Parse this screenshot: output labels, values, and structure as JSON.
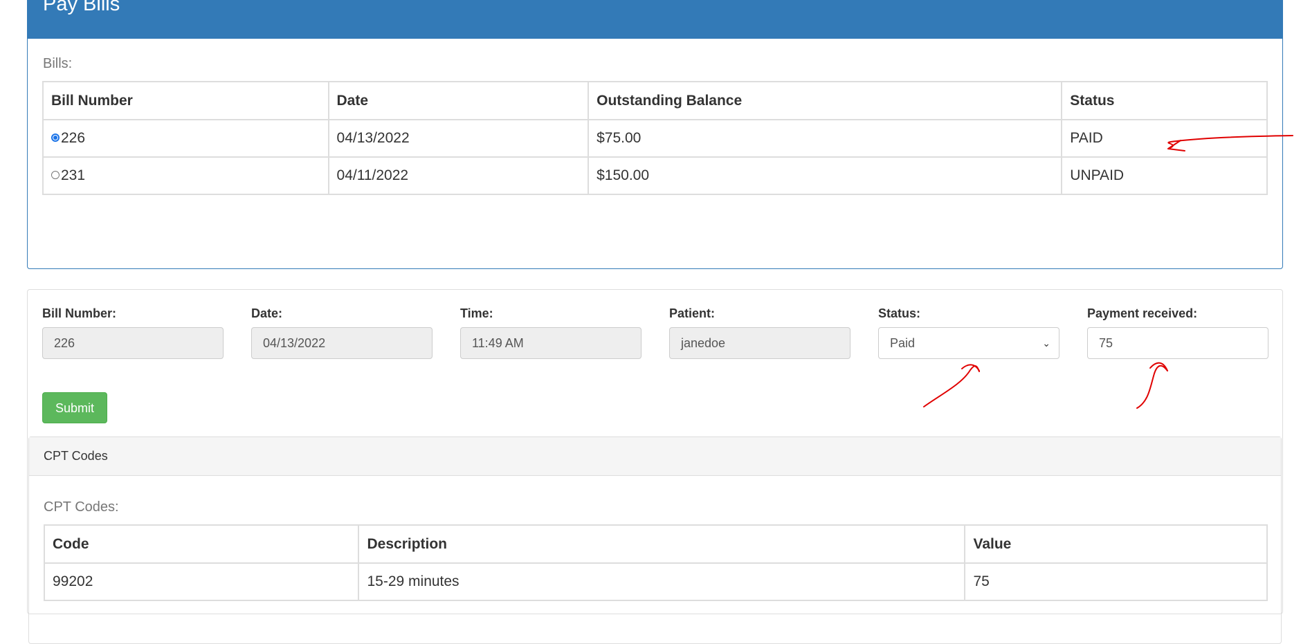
{
  "bills_panel": {
    "title": "Pay Bills",
    "bills_label": "Bills:",
    "columns": [
      "Bill Number",
      "Date",
      "Outstanding Balance",
      "Status"
    ],
    "rows": [
      {
        "bill_number": "226",
        "date": "04/13/2022",
        "balance": "$75.00",
        "status": "PAID",
        "selected": true
      },
      {
        "bill_number": "231",
        "date": "04/11/2022",
        "balance": "$150.00",
        "status": "UNPAID",
        "selected": false
      }
    ]
  },
  "form": {
    "bill_number": {
      "label": "Bill Number:",
      "value": "226"
    },
    "date": {
      "label": "Date:",
      "value": "04/13/2022"
    },
    "time": {
      "label": "Time:",
      "value": "11:49  AM"
    },
    "patient": {
      "label": "Patient:",
      "value": "janedoe"
    },
    "status": {
      "label": "Status:",
      "value": "Paid"
    },
    "payment_received": {
      "label": "Payment received:",
      "value": "75"
    },
    "submit_label": "Submit"
  },
  "cpt_panel": {
    "heading": "CPT Codes",
    "label": "CPT Codes:",
    "columns": [
      "Code",
      "Description",
      "Value"
    ],
    "rows": [
      {
        "code": "99202",
        "description": "15-29 minutes",
        "value": "75"
      }
    ]
  },
  "colors": {
    "primary_blue": "#337ab7",
    "success_green": "#5cb85c",
    "annotation_red": "#e00000"
  }
}
